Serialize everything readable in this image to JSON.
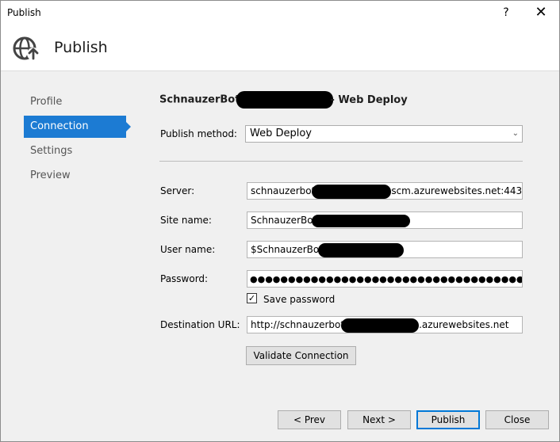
{
  "window": {
    "title": "Publish",
    "help_glyph": "?",
    "close_glyph": "✕"
  },
  "header": {
    "title": "Publish",
    "icon": "publish-globe-icon"
  },
  "nav": {
    "items": [
      {
        "label": "Profile",
        "active": false
      },
      {
        "label": "Connection",
        "active": true
      },
      {
        "label": "Settings",
        "active": false
      },
      {
        "label": "Preview",
        "active": false
      }
    ]
  },
  "connection": {
    "heading_prefix": "SchnauzerBot",
    "heading_suffix": "- Web Deploy",
    "publish_method_label": "Publish method:",
    "publish_method_value": "Web Deploy",
    "server_label": "Server:",
    "server_prefix": "schnauzerbot",
    "server_suffix": "scm.azurewebsites.net:443",
    "site_name_label": "Site name:",
    "site_name_prefix": "SchnauzerBot",
    "user_name_label": "User name:",
    "user_name_prefix": "$SchnauzerBot",
    "password_label": "Password:",
    "password_mask": "●●●●●●●●●●●●●●●●●●●●●●●●●●●●●●●●●●●●●●",
    "save_password_label": "Save password",
    "save_password_checked": true,
    "destination_url_label": "Destination URL:",
    "destination_url_prefix": "http://schnauzerbot",
    "destination_url_suffix": ".azurewebsites.net",
    "validate_label": "Validate Connection"
  },
  "footer": {
    "prev_label": "< Prev",
    "next_label": "Next >",
    "publish_label": "Publish",
    "close_label": "Close"
  },
  "colors": {
    "accent": "#1c7bd3",
    "redaction": "#000000"
  }
}
